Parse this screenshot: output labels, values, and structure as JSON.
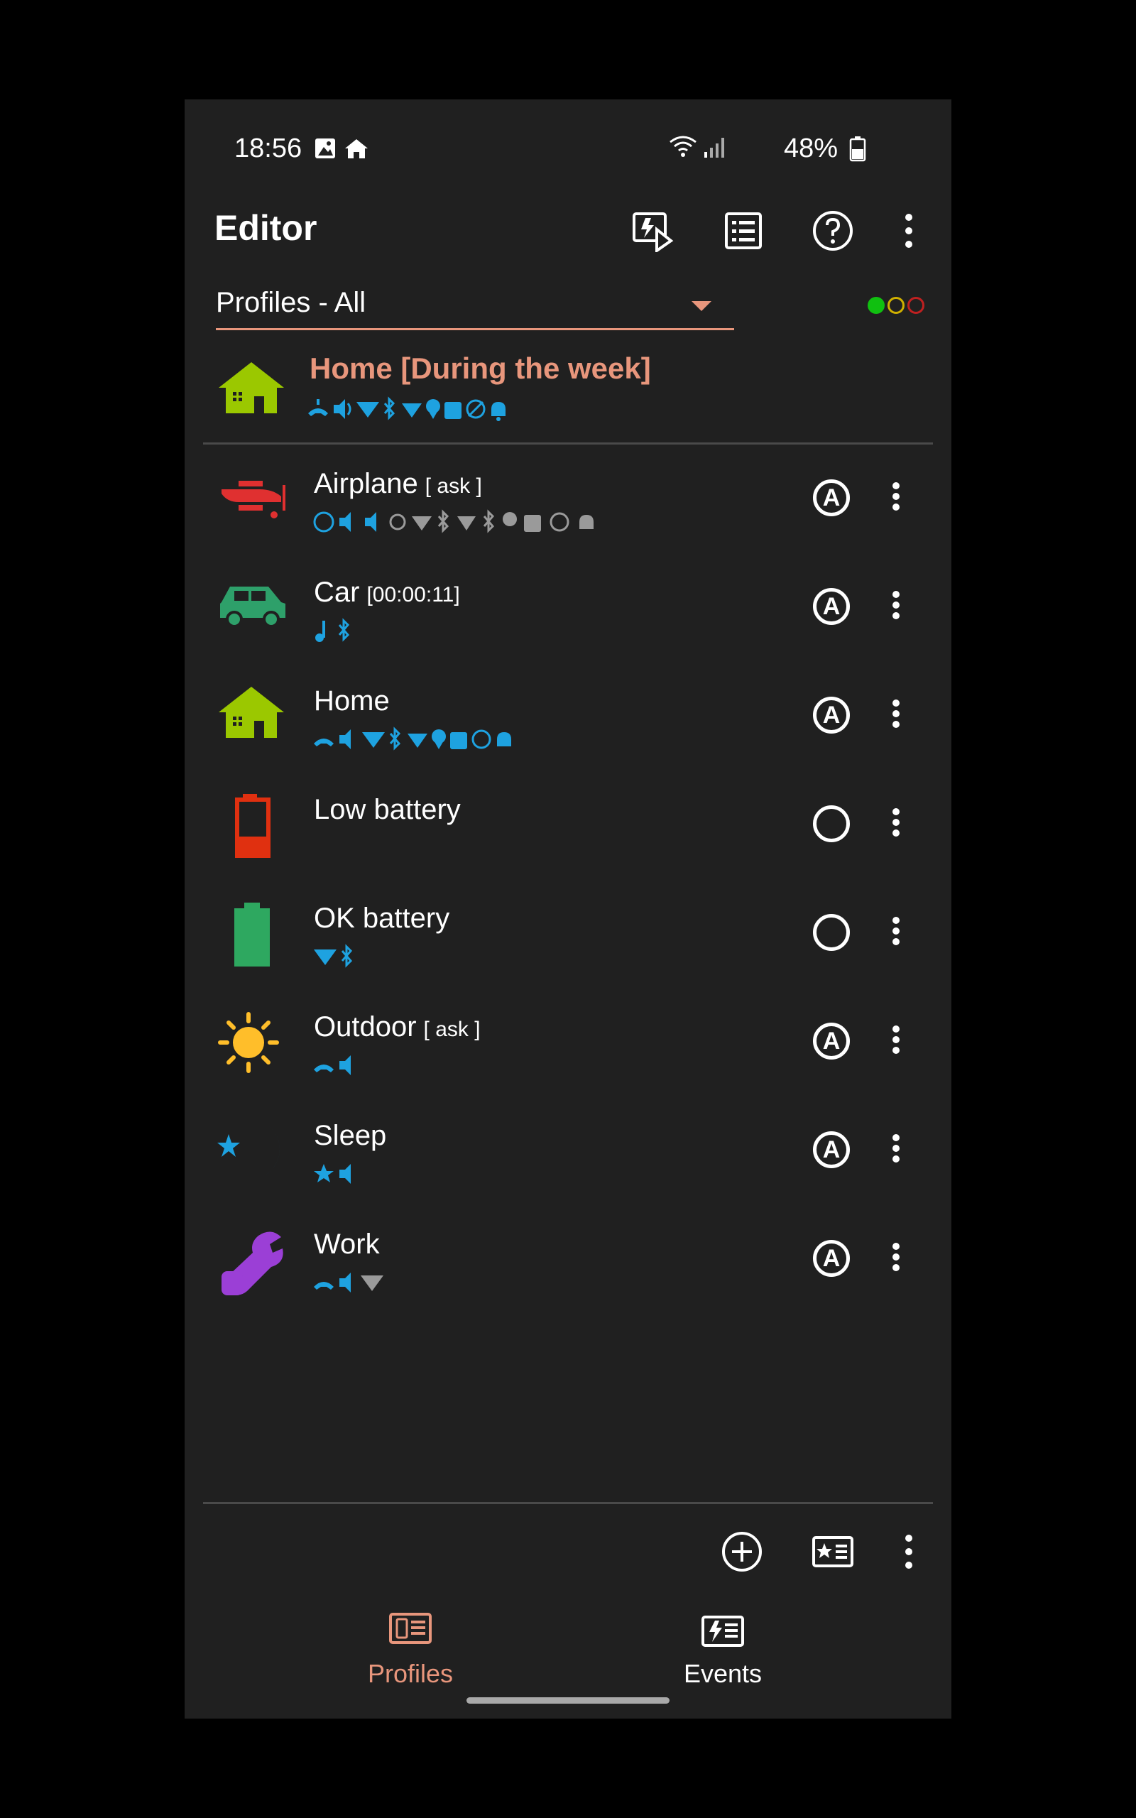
{
  "status_bar": {
    "time": "18:56",
    "battery_percent": "48%"
  },
  "toolbar": {
    "title": "Editor",
    "icons": [
      "activate-profile-icon",
      "event-list-icon",
      "help-icon",
      "overflow-menu-icon"
    ]
  },
  "filter": {
    "selected": "Profiles - All"
  },
  "status_dots": {
    "colors": [
      "#10c010",
      "#d0b000",
      "#c02020"
    ]
  },
  "active_profile": {
    "title": "Home [During the week]"
  },
  "profiles": [
    {
      "name": "Airplane",
      "tag": "[ ask ]",
      "state": "A",
      "icon": "airplane-icon"
    },
    {
      "name": "Car",
      "tag": "[00:00:11]",
      "state": "A",
      "icon": "car-icon"
    },
    {
      "name": "Home",
      "tag": "",
      "state": "A",
      "icon": "house-icon"
    },
    {
      "name": "Low battery",
      "tag": "",
      "state": "",
      "icon": "battery-low-icon"
    },
    {
      "name": "OK battery",
      "tag": "",
      "state": "",
      "icon": "battery-full-icon"
    },
    {
      "name": "Outdoor",
      "tag": "[ ask ]",
      "state": "A",
      "icon": "sun-icon"
    },
    {
      "name": "Sleep",
      "tag": "",
      "state": "A",
      "icon": "moon-star-icon"
    },
    {
      "name": "Work",
      "tag": "",
      "state": "A",
      "icon": "wrench-icon"
    }
  ],
  "bottom_bar": {
    "icons": [
      "add-profile-icon",
      "profile-card-icon",
      "overflow-menu-icon"
    ]
  },
  "nav": {
    "profiles_label": "Profiles",
    "events_label": "Events",
    "active_color": "#e8967c"
  },
  "colors": {
    "accent": "#e8967c",
    "icon_blue": "#1ea2e0",
    "background": "#202020"
  }
}
